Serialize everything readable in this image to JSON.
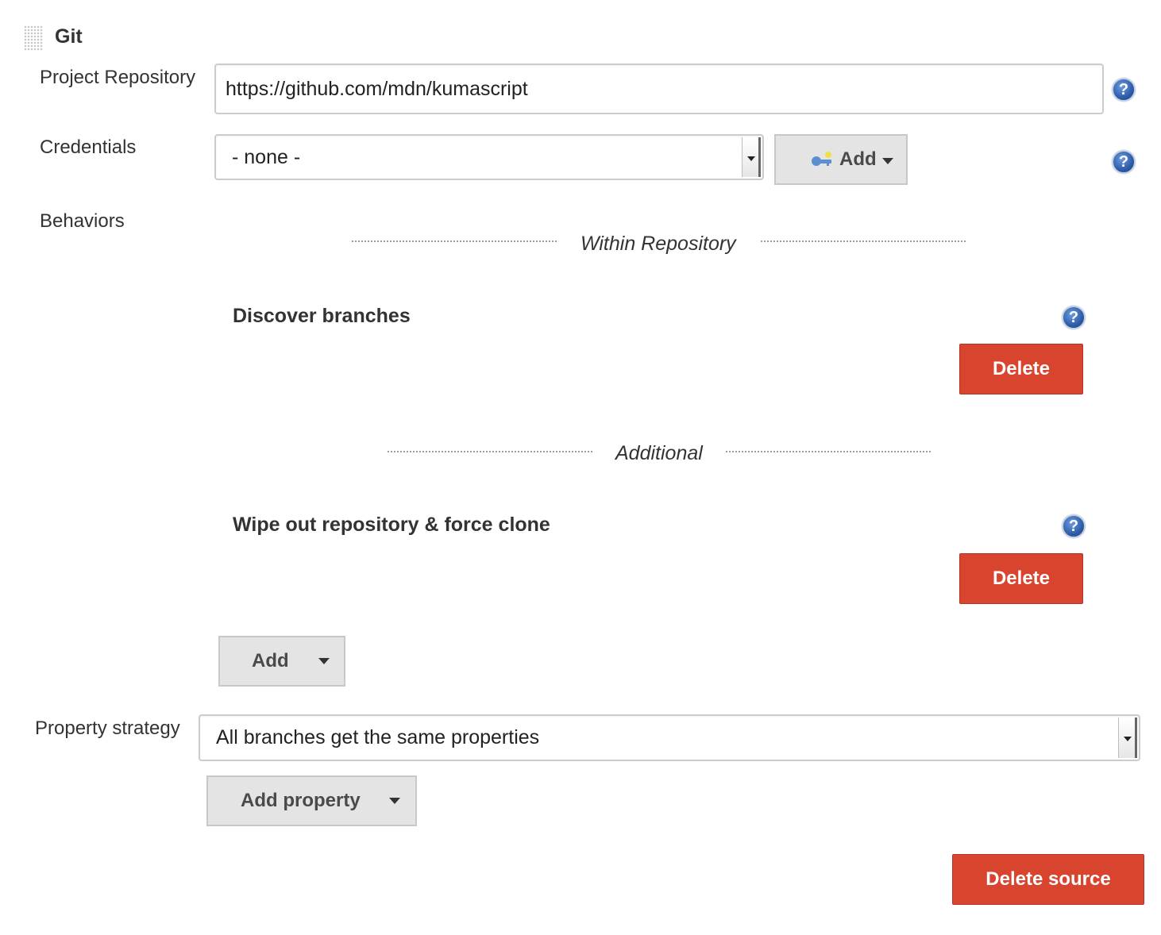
{
  "section": {
    "title": "Git"
  },
  "project_repository": {
    "label": "Project Repository",
    "value": "https://github.com/mdn/kumascript"
  },
  "credentials": {
    "label": "Credentials",
    "selected": "- none -",
    "add_label": "Add",
    "add_icon": "key-icon"
  },
  "behaviors": {
    "label": "Behaviors",
    "groups": [
      {
        "heading": "Within Repository",
        "items": [
          {
            "title": "Discover branches",
            "delete_label": "Delete"
          }
        ]
      },
      {
        "heading": "Additional",
        "items": [
          {
            "title": "Wipe out repository & force clone",
            "delete_label": "Delete"
          }
        ]
      }
    ],
    "add_label": "Add"
  },
  "property_strategy": {
    "label": "Property strategy",
    "selected": "All branches get the same properties",
    "add_property_label": "Add property"
  },
  "delete_source_label": "Delete source",
  "help_icon_glyph": "?",
  "colors": {
    "danger": "#d9442f",
    "help": "#2e5ca8",
    "button_gray": "#e4e4e4"
  }
}
